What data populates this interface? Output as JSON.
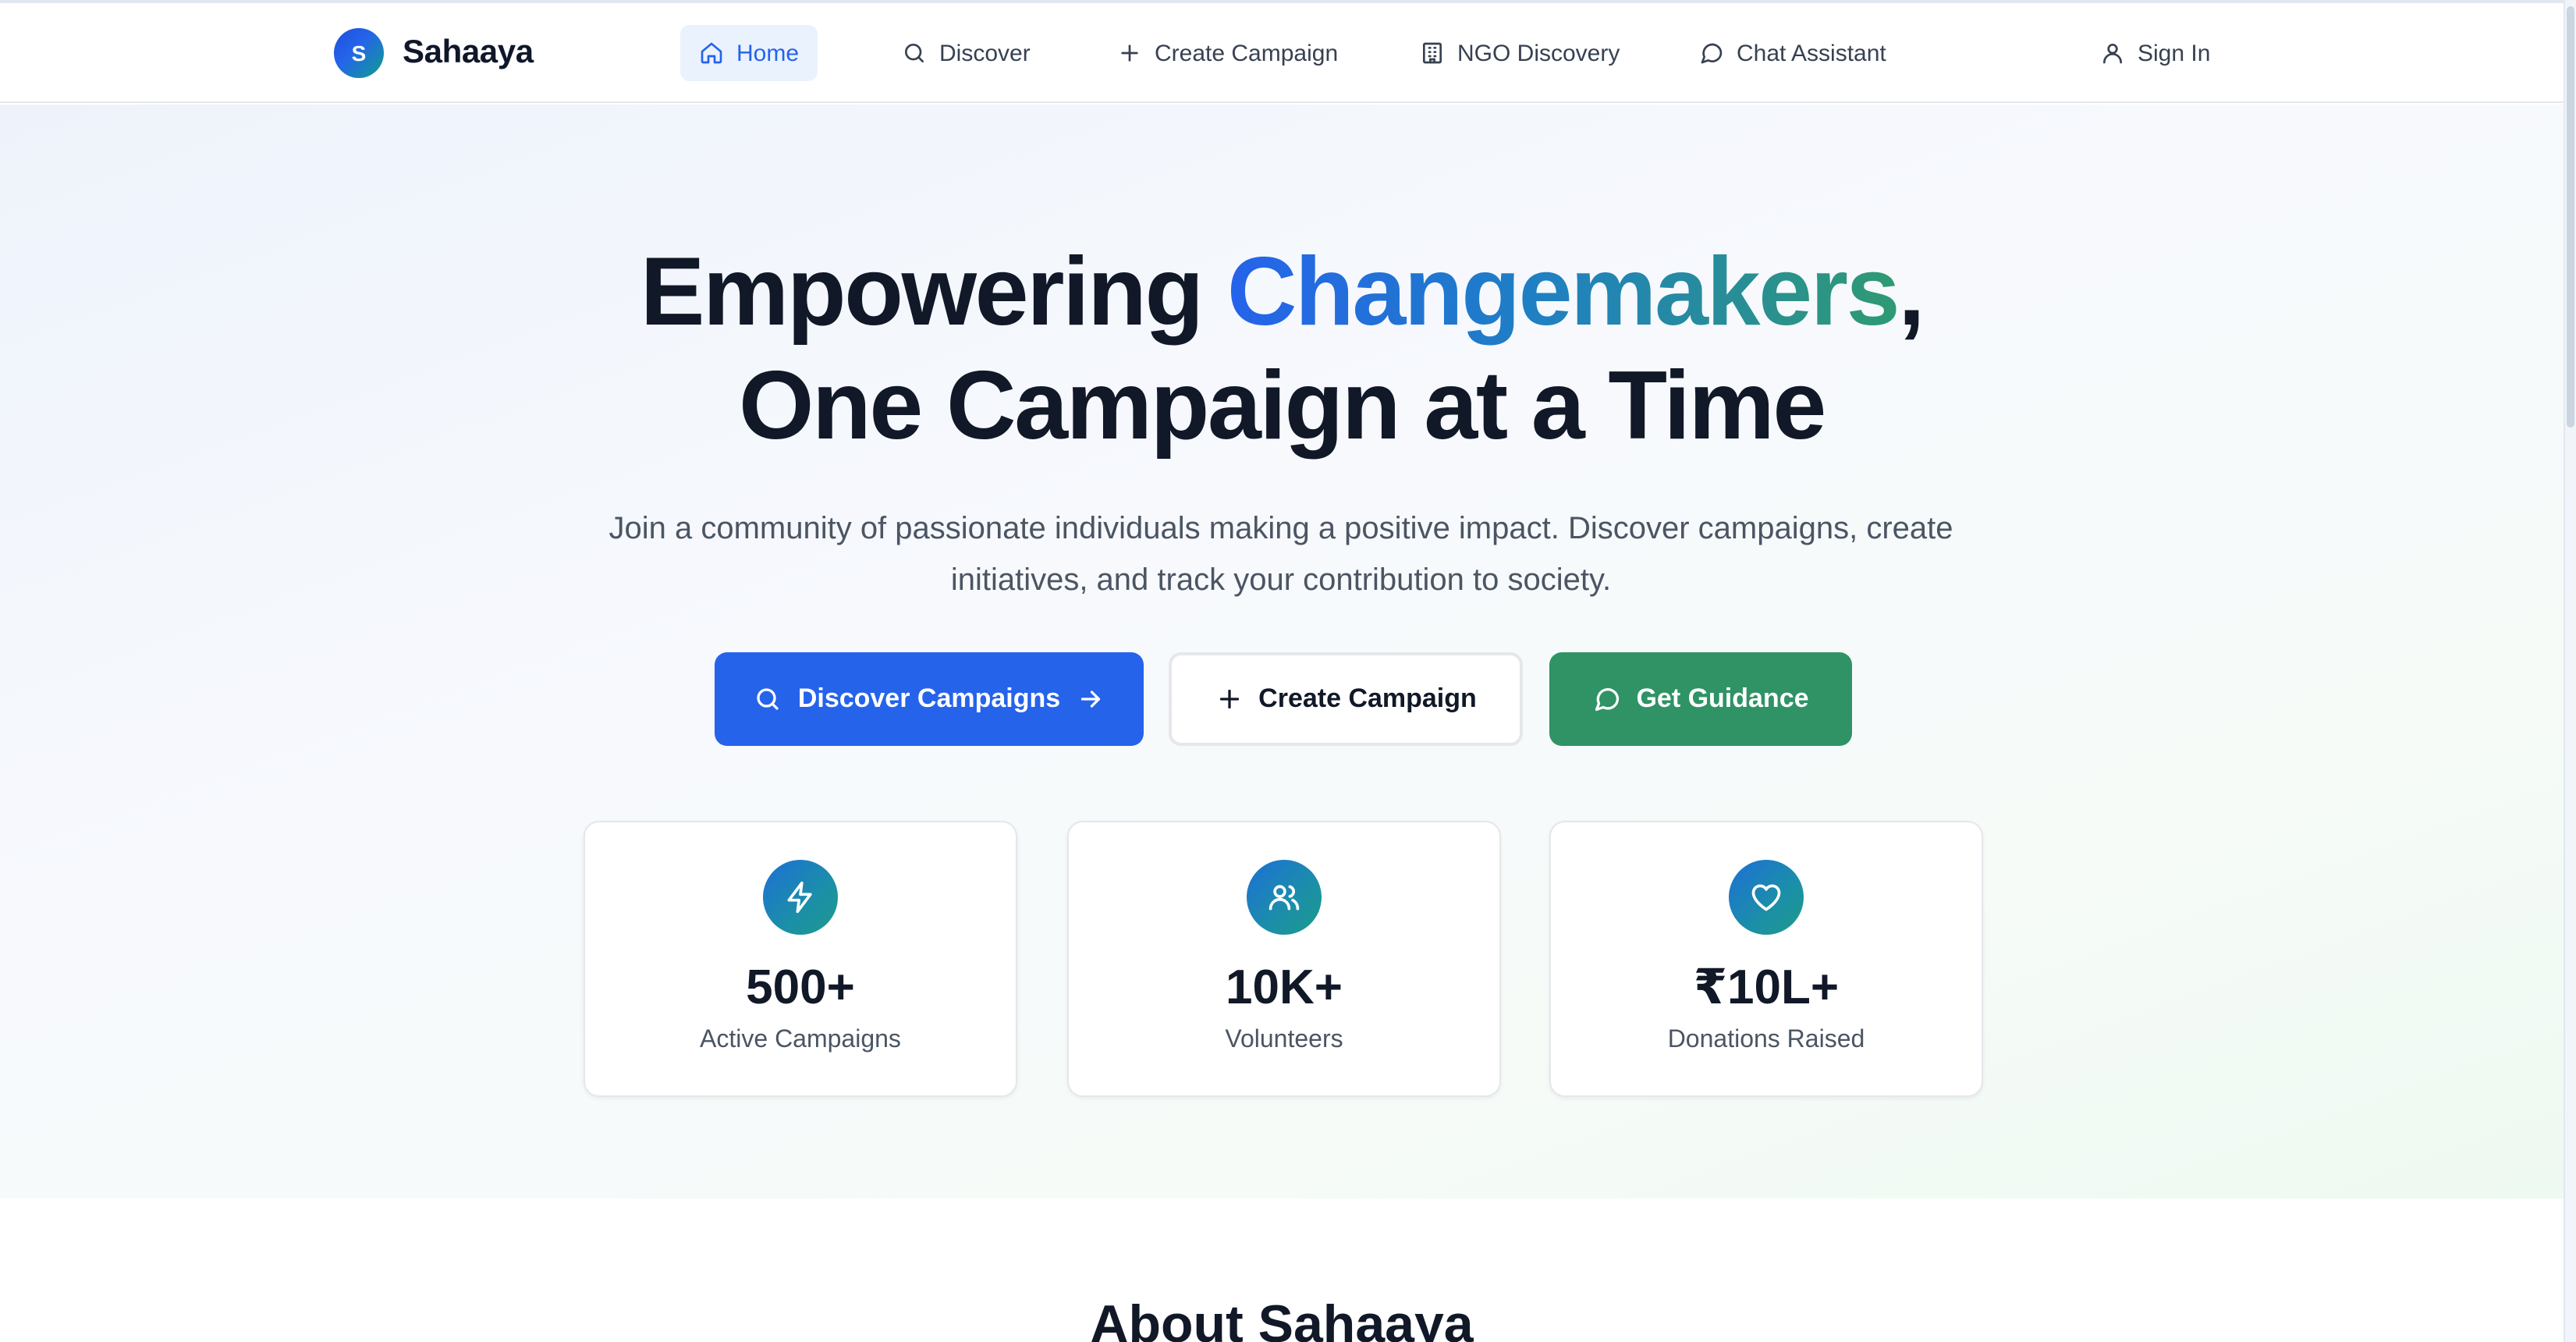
{
  "brand": {
    "initial": "S",
    "name": "Sahaaya"
  },
  "nav": {
    "items": [
      {
        "label": "Home",
        "icon": "home-icon",
        "active": true
      },
      {
        "label": "Discover",
        "icon": "search-icon"
      },
      {
        "label": "Create Campaign",
        "icon": "plus-icon"
      },
      {
        "label": "NGO Discovery",
        "icon": "building-icon"
      },
      {
        "label": "Chat Assistant",
        "icon": "message-circle-icon"
      }
    ],
    "sign_in": "Sign In"
  },
  "hero": {
    "title_part1": "Empowering ",
    "title_highlight": "Changemakers",
    "title_comma": ",",
    "title_line2": "One Campaign at a Time",
    "subtitle": "Join a community of passionate individuals making a positive impact. Discover campaigns, create initiatives, and track your contribution to society.",
    "buttons": {
      "discover": "Discover Campaigns",
      "create": "Create Campaign",
      "guidance": "Get Guidance"
    }
  },
  "stats": [
    {
      "value": "500+",
      "label": "Active Campaigns",
      "icon": "zap-icon"
    },
    {
      "value": "10K+",
      "label": "Volunteers",
      "icon": "users-icon"
    },
    {
      "value": "₹10L+",
      "label": "Donations Raised",
      "icon": "heart-icon"
    }
  ],
  "about": {
    "heading": "About Sahaaya"
  },
  "colors": {
    "primary": "#2563eb",
    "green": "#2f9365",
    "text": "#111827",
    "muted": "#4b5563"
  }
}
